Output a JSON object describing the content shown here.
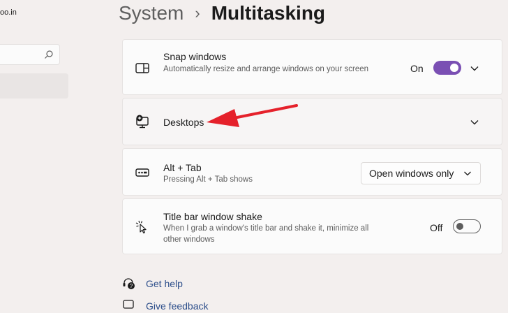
{
  "sidebar": {
    "account_text": "oo.in"
  },
  "breadcrumb": {
    "parent": "System",
    "separator": "›",
    "current": "Multitasking"
  },
  "settings": {
    "snap_windows": {
      "title": "Snap windows",
      "description": "Automatically resize and arrange windows on your screen",
      "state_label": "On",
      "state": "on",
      "icon": "snap-layout-icon"
    },
    "desktops": {
      "title": "Desktops",
      "icon": "desktop-add-icon"
    },
    "alt_tab": {
      "title": "Alt + Tab",
      "description": "Pressing Alt + Tab shows",
      "selected_option": "Open windows only",
      "icon": "alt-tab-icon"
    },
    "title_bar_shake": {
      "title": "Title bar window shake",
      "description": "When I grab a window's title bar and shake it, minimize all other windows",
      "state_label": "Off",
      "state": "off",
      "icon": "cursor-shake-icon"
    }
  },
  "links": {
    "get_help": "Get help",
    "give_feedback": "Give feedback"
  },
  "colors": {
    "accent": "#7a4fb3",
    "annotation_arrow": "#e5212b",
    "background": "#f3efee",
    "card": "#fbfbfb"
  }
}
